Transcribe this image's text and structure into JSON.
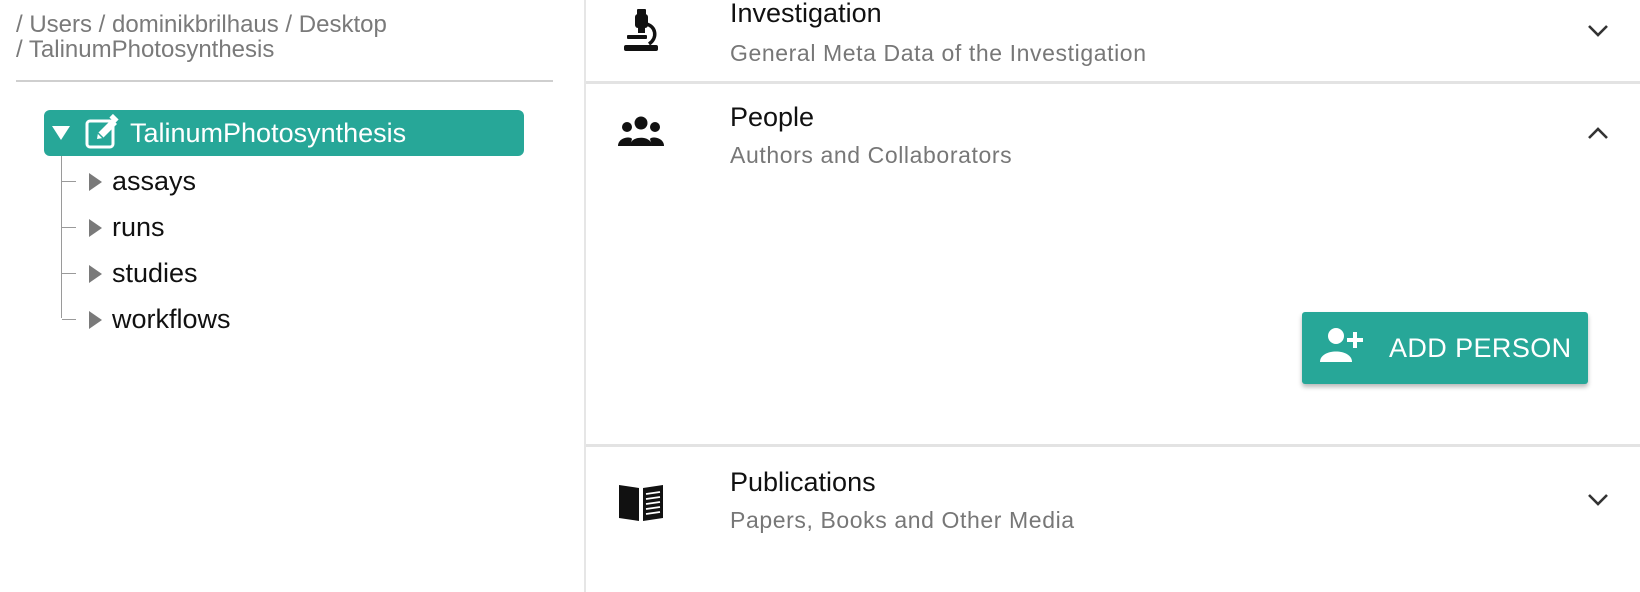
{
  "breadcrumb": {
    "line1": "/ Users / dominikbrilhaus / Desktop",
    "line2": "/ TalinumPhotosynthesis"
  },
  "tree": {
    "root": {
      "label": "TalinumPhotosynthesis",
      "icon": "edit-icon",
      "expanded": true
    },
    "children": [
      {
        "label": "assays"
      },
      {
        "label": "runs"
      },
      {
        "label": "studies"
      },
      {
        "label": "workflows"
      }
    ]
  },
  "sections": {
    "investigation": {
      "title": "Investigation",
      "subtitle": "General Meta Data of the Investigation",
      "icon": "microscope-icon",
      "expanded": false
    },
    "people": {
      "title": "People",
      "subtitle": "Authors and Collaborators",
      "icon": "people-icon",
      "expanded": true,
      "add_button_label": "ADD PERSON"
    },
    "publications": {
      "title": "Publications",
      "subtitle": "Papers, Books and Other Media",
      "icon": "book-icon",
      "expanded": false
    }
  },
  "colors": {
    "accent": "#27a798",
    "text": "#111111",
    "muted": "#777777",
    "divider": "#e3e3e3"
  }
}
